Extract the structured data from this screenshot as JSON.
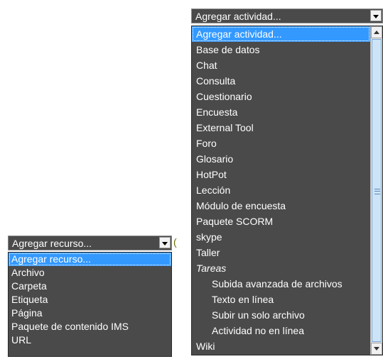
{
  "activity_selector": {
    "selected": "Agregar actividad...",
    "options": [
      {
        "label": "Agregar actividad...",
        "selected": true
      },
      {
        "label": "Base de datos"
      },
      {
        "label": "Chat"
      },
      {
        "label": "Consulta"
      },
      {
        "label": "Cuestionario"
      },
      {
        "label": "Encuesta"
      },
      {
        "label": "External Tool"
      },
      {
        "label": "Foro"
      },
      {
        "label": "Glosario"
      },
      {
        "label": "HotPot"
      },
      {
        "label": "Lección"
      },
      {
        "label": "Módulo de encuesta"
      },
      {
        "label": "Paquete SCORM"
      },
      {
        "label": "skype"
      },
      {
        "label": "Taller"
      },
      {
        "label": "Tareas",
        "group": true
      },
      {
        "label": "Subida avanzada de archivos",
        "child": true
      },
      {
        "label": "Texto en línea",
        "child": true
      },
      {
        "label": "Subir un solo archivo",
        "child": true
      },
      {
        "label": "Actividad no en línea",
        "child": true
      },
      {
        "label": "Wiki"
      }
    ]
  },
  "resource_selector": {
    "selected": "Agregar recurso...",
    "options": [
      {
        "label": "Agregar recurso...",
        "selected": true
      },
      {
        "label": "Archivo"
      },
      {
        "label": "Carpeta"
      },
      {
        "label": "Etiqueta"
      },
      {
        "label": "Página"
      },
      {
        "label": "Paquete de contenido IMS"
      },
      {
        "label": "URL"
      }
    ]
  },
  "edge_char": "(",
  "colors": {
    "list_bg": "#4a4a4a",
    "highlight": "#3399ff",
    "text": "#ffffff"
  }
}
